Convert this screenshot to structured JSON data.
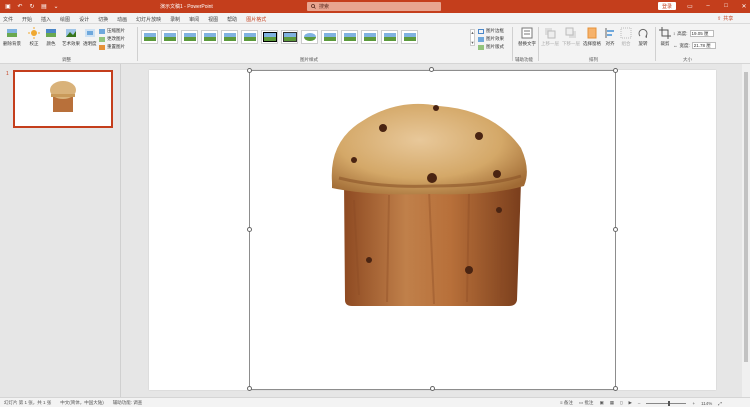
{
  "titlebar": {
    "title": "演示文稿1 - PowerPoint",
    "search_placeholder": "搜索",
    "login_label": "登录"
  },
  "menu": {
    "tabs": [
      "文件",
      "开始",
      "插入",
      "绘图",
      "设计",
      "切换",
      "动画",
      "幻灯片放映",
      "录制",
      "审阅",
      "视图",
      "帮助",
      "图片格式"
    ],
    "share_label": "共享"
  },
  "ribbon": {
    "adjust": {
      "remove_bg": "删除背景",
      "correct": "校正",
      "color": "颜色",
      "art_effects": "艺术效果",
      "transparency": "透明度",
      "compress": "压缩图片",
      "change": "更改图片",
      "reset": "重置图片",
      "group_label": "调整"
    },
    "styles": {
      "group_label": "图片样式",
      "border": "图片边框",
      "effects": "图片效果",
      "layout": "图片版式"
    },
    "accessibility": {
      "alt_text": "替换文字",
      "group_label": "辅助功能"
    },
    "arrange": {
      "forward": "上移一层",
      "backward": "下移一层",
      "selection_pane": "选择窗格",
      "align": "对齐",
      "group": "组合",
      "rotate": "旋转",
      "group_label": "排列"
    },
    "size": {
      "crop": "裁剪",
      "height_label": "高度:",
      "height_value": "19.05 厘",
      "width_label": "宽度:",
      "width_value": "21.78 厘",
      "group_label": "大小"
    }
  },
  "slides": {
    "current_number": "1"
  },
  "statusbar": {
    "slide_info": "幻灯片 第 1 张，共 1 张",
    "language": "中文(简体，中国大陆)",
    "accessibility": "辅助功能: 调查",
    "notes": "备注",
    "comments": "批注",
    "zoom": "114%"
  },
  "colors": {
    "accent": "#c43e1c",
    "bread_crust": "#b8703a",
    "bread_top": "#d9b27a"
  }
}
